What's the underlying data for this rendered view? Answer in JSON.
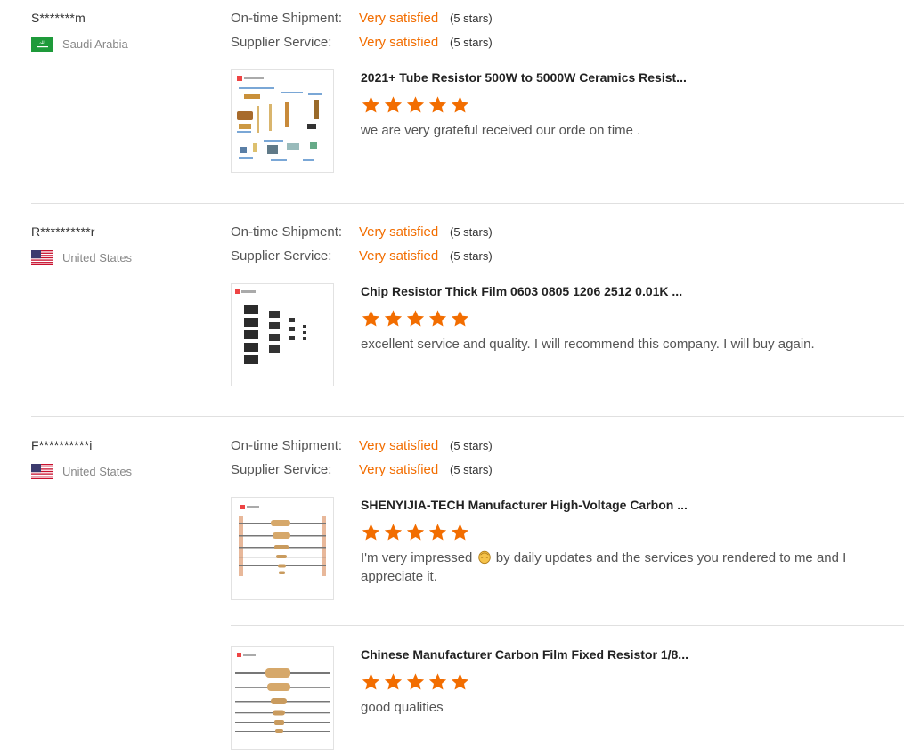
{
  "labels": {
    "ontime": "On-time Shipment:",
    "supplier": "Supplier Service:"
  },
  "accent_color": "#f26d00",
  "reviews": [
    {
      "buyer": "S*******m",
      "country": "Saudi Arabia",
      "flag_icon": "saudi-arabia-flag-icon",
      "ontime_value": "Very satisfied",
      "ontime_stars": "(5 stars)",
      "supplier_value": "Very satisfied",
      "supplier_stars": "(5 stars)",
      "products": [
        {
          "title": "2021+ Tube Resistor 500W to 5000W Ceramics Resist...",
          "rating": 5,
          "comment": "we are very grateful received our orde on time ."
        }
      ]
    },
    {
      "buyer": "R**********r",
      "country": "United States",
      "flag_icon": "united-states-flag-icon",
      "ontime_value": "Very satisfied",
      "ontime_stars": "(5 stars)",
      "supplier_value": "Very satisfied",
      "supplier_stars": "(5 stars)",
      "products": [
        {
          "title": "Chip Resistor Thick Film 0603 0805 1206 2512 0.01K ...",
          "rating": 5,
          "comment": "excellent service and quality. I will recommend this company. I will buy again."
        }
      ]
    },
    {
      "buyer": "F**********i",
      "country": "United States",
      "flag_icon": "united-states-flag-icon",
      "ontime_value": "Very satisfied",
      "ontime_stars": "(5 stars)",
      "supplier_value": "Very satisfied",
      "supplier_stars": "(5 stars)",
      "products": [
        {
          "title": "SHENYIJIA-TECH Manufacturer High-Voltage Carbon ...",
          "rating": 5,
          "comment_before": "I'm very impressed",
          "comment_emoji": "clapping-hands-emoji",
          "comment_after": "by daily updates and the services you rendered to me and I appreciate it."
        },
        {
          "title": "Chinese Manufacturer Carbon Film Fixed Resistor 1/8...",
          "rating": 5,
          "comment": "good qualities"
        }
      ]
    }
  ]
}
